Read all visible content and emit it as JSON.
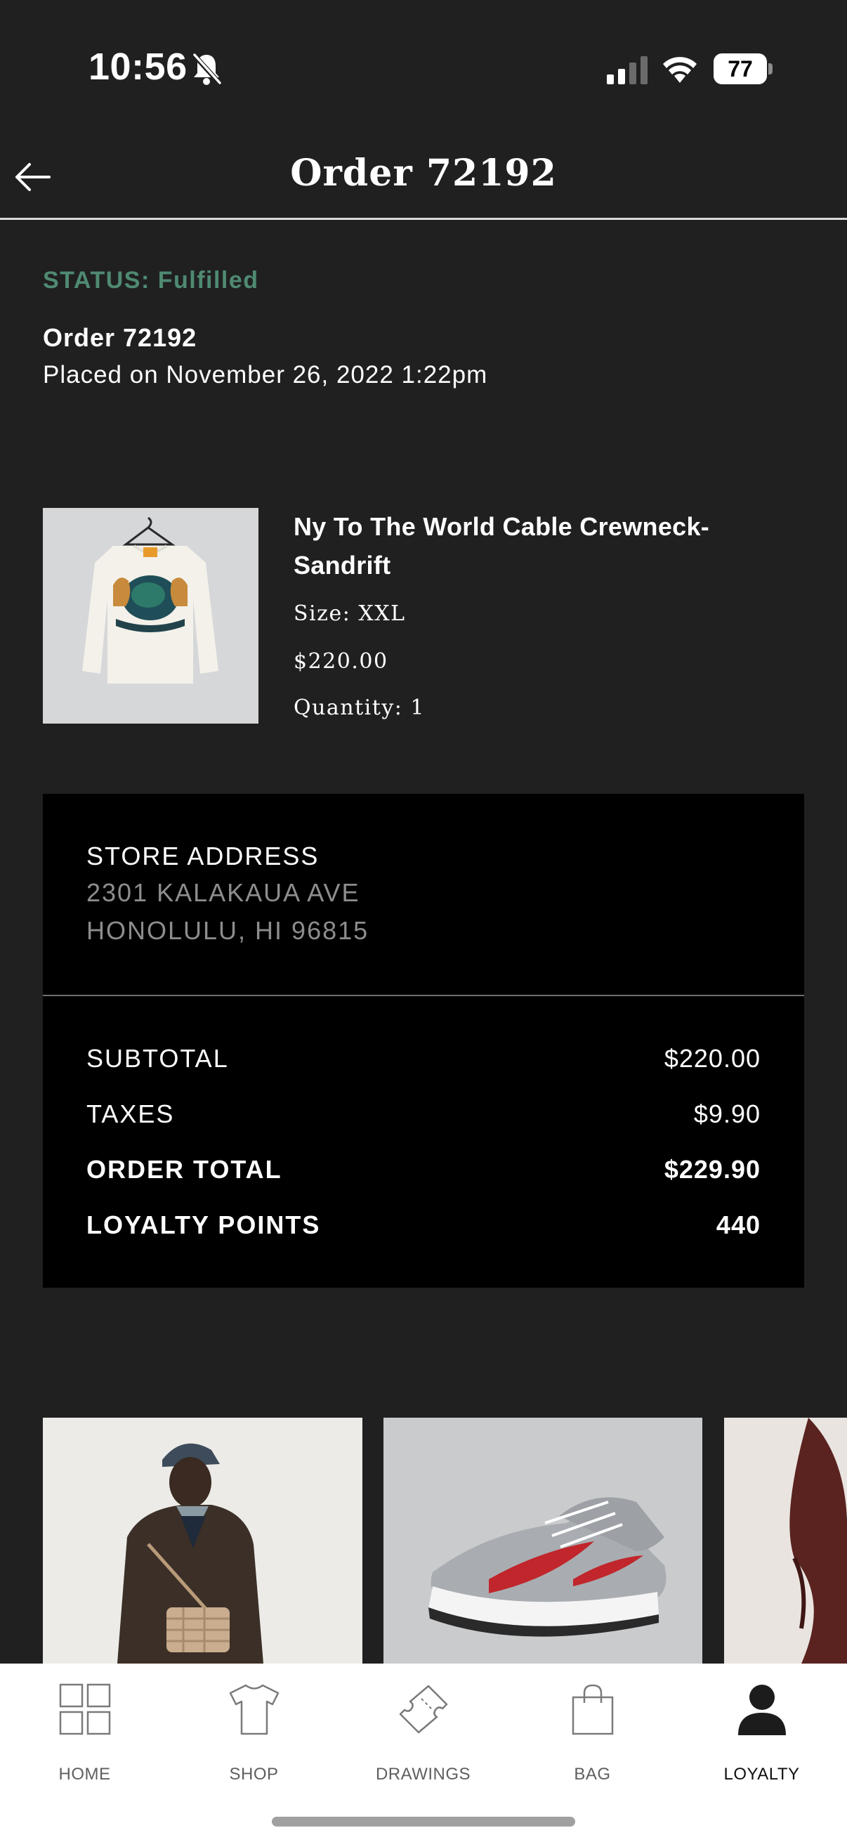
{
  "status_bar": {
    "time": "10:56",
    "battery": "77",
    "icons": [
      "bell-slash-icon",
      "cellular-signal-icon",
      "wifi-icon",
      "battery-icon"
    ]
  },
  "header": {
    "back_icon": "arrow-left-icon",
    "title": "Order 72192"
  },
  "order": {
    "status": "STATUS: Fulfilled",
    "number": "Order 72192",
    "placed": "Placed on November 26, 2022 1:22pm",
    "status_color": "#4f8a72"
  },
  "product": {
    "name": "Ny To The World Cable Crewneck-Sandrift",
    "size": "Size: XXL",
    "price": "$220.00",
    "quantity": "Quantity: 1"
  },
  "store": {
    "heading": "STORE ADDRESS",
    "line1": "2301 KALAKAUA AVE",
    "line2": "HONOLULU, HI 96815"
  },
  "totals": {
    "subtotal_label": "SUBTOTAL",
    "subtotal_value": "$220.00",
    "taxes_label": "TAXES",
    "taxes_value": "$9.90",
    "total_label": "ORDER TOTAL",
    "total_value": "$229.90",
    "points_label": "LOYALTY POINTS",
    "points_value": "440"
  },
  "tabs": [
    {
      "label": "HOME",
      "icon": "grid-icon"
    },
    {
      "label": "SHOP",
      "icon": "tshirt-icon"
    },
    {
      "label": "DRAWINGS",
      "icon": "ticket-icon"
    },
    {
      "label": "BAG",
      "icon": "shopping-bag-icon"
    },
    {
      "label": "LOYALTY",
      "icon": "person-icon",
      "active": true
    }
  ]
}
